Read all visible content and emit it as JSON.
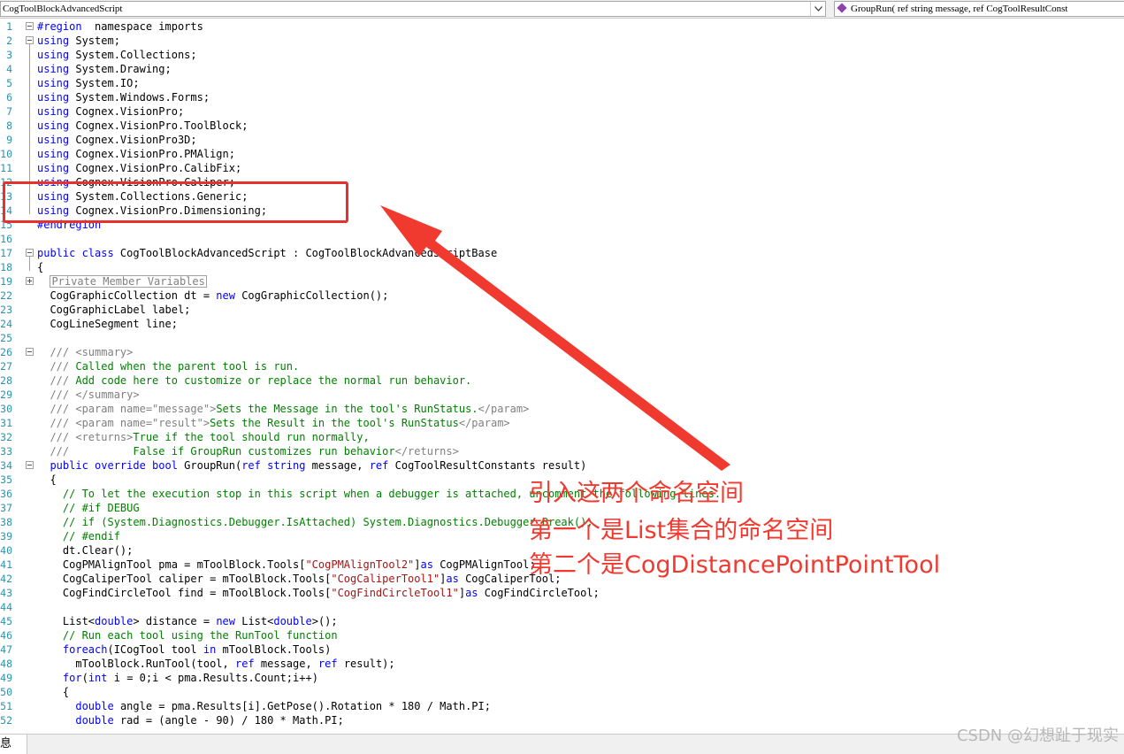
{
  "toolbar": {
    "class_combo": "CogToolBlockAdvancedScript",
    "method_combo": "GroupRun( ref string message,  ref CogToolResultConst"
  },
  "code_lines": [
    {
      "n": "1",
      "fold": "minus",
      "parts": [
        [
          "kw",
          "#region"
        ],
        [
          "",
          "  namespace imports"
        ]
      ]
    },
    {
      "n": "2",
      "fold": "minus",
      "parts": [
        [
          "kw",
          "using"
        ],
        [
          "",
          " System;"
        ]
      ]
    },
    {
      "n": "3",
      "parts": [
        [
          "kw",
          "using"
        ],
        [
          "",
          " System.Collections;"
        ]
      ]
    },
    {
      "n": "4",
      "parts": [
        [
          "kw",
          "using"
        ],
        [
          "",
          " System.Drawing;"
        ]
      ]
    },
    {
      "n": "5",
      "parts": [
        [
          "kw",
          "using"
        ],
        [
          "",
          " System.IO;"
        ]
      ]
    },
    {
      "n": "6",
      "parts": [
        [
          "kw",
          "using"
        ],
        [
          "",
          " System.Windows.Forms;"
        ]
      ]
    },
    {
      "n": "7",
      "parts": [
        [
          "kw",
          "using"
        ],
        [
          "",
          " Cognex.VisionPro;"
        ]
      ]
    },
    {
      "n": "8",
      "parts": [
        [
          "kw",
          "using"
        ],
        [
          "",
          " Cognex.VisionPro.ToolBlock;"
        ]
      ]
    },
    {
      "n": "9",
      "parts": [
        [
          "kw",
          "using"
        ],
        [
          "",
          " Cognex.VisionPro3D;"
        ]
      ]
    },
    {
      "n": "10",
      "parts": [
        [
          "kw",
          "using"
        ],
        [
          "",
          " Cognex.VisionPro.PMAlign;"
        ]
      ]
    },
    {
      "n": "11",
      "parts": [
        [
          "kw",
          "using"
        ],
        [
          "",
          " Cognex.VisionPro.CalibFix;"
        ]
      ]
    },
    {
      "n": "12",
      "parts": [
        [
          "kw",
          "using"
        ],
        [
          "",
          " Cognex.VisionPro.Caliper;"
        ]
      ]
    },
    {
      "n": "13",
      "parts": [
        [
          "kw",
          "using"
        ],
        [
          "",
          " System.Collections.Generic;"
        ]
      ]
    },
    {
      "n": "14",
      "parts": [
        [
          "kw",
          "using"
        ],
        [
          "",
          " Cognex.VisionPro.Dimensioning;"
        ]
      ]
    },
    {
      "n": "15",
      "parts": [
        [
          "kw",
          "#endregion"
        ]
      ]
    },
    {
      "n": "16",
      "parts": []
    },
    {
      "n": "17",
      "fold": "minus",
      "parts": [
        [
          "kw",
          "public class"
        ],
        [
          "",
          " CogToolBlockAdvancedScript : CogToolBlockAdvancedScriptBase"
        ]
      ]
    },
    {
      "n": "18",
      "parts": [
        [
          "",
          "{"
        ]
      ]
    },
    {
      "n": "19",
      "fold": "plus",
      "indent": "  ",
      "parts": [
        [
          "collapsed",
          "Private Member Variables"
        ]
      ]
    },
    {
      "n": "22",
      "indent": "  ",
      "parts": [
        [
          "",
          "CogGraphicCollection dt = "
        ],
        [
          "kw",
          "new"
        ],
        [
          "",
          " CogGraphicCollection();"
        ]
      ]
    },
    {
      "n": "23",
      "indent": "  ",
      "parts": [
        [
          "",
          "CogGraphicLabel label;"
        ]
      ]
    },
    {
      "n": "24",
      "indent": "  ",
      "parts": [
        [
          "",
          "CogLineSegment line;"
        ]
      ]
    },
    {
      "n": "25",
      "parts": []
    },
    {
      "n": "26",
      "fold": "minus",
      "indent": "  ",
      "parts": [
        [
          "xml",
          "/// "
        ],
        [
          "xml",
          "<summary>"
        ]
      ]
    },
    {
      "n": "27",
      "indent": "  ",
      "parts": [
        [
          "xml",
          "/// "
        ],
        [
          "cm",
          "Called when the parent tool is run."
        ]
      ]
    },
    {
      "n": "28",
      "indent": "  ",
      "parts": [
        [
          "xml",
          "/// "
        ],
        [
          "cm",
          "Add code here to customize or replace the normal run behavior."
        ]
      ]
    },
    {
      "n": "29",
      "indent": "  ",
      "parts": [
        [
          "xml",
          "/// "
        ],
        [
          "xml",
          "</summary>"
        ]
      ]
    },
    {
      "n": "30",
      "indent": "  ",
      "parts": [
        [
          "xml",
          "/// "
        ],
        [
          "xml",
          "<param name=\"message\">"
        ],
        [
          "cm",
          "Sets the Message in the tool's RunStatus."
        ],
        [
          "xml",
          "</param>"
        ]
      ]
    },
    {
      "n": "31",
      "indent": "  ",
      "parts": [
        [
          "xml",
          "/// "
        ],
        [
          "xml",
          "<param name=\"result\">"
        ],
        [
          "cm",
          "Sets the Result in the tool's RunStatus"
        ],
        [
          "xml",
          "</param>"
        ]
      ]
    },
    {
      "n": "32",
      "indent": "  ",
      "parts": [
        [
          "xml",
          "/// "
        ],
        [
          "xml",
          "<returns>"
        ],
        [
          "cm",
          "True if the tool should run normally,"
        ]
      ]
    },
    {
      "n": "33",
      "indent": "  ",
      "parts": [
        [
          "xml",
          "///"
        ],
        [
          "cm",
          "          False if GroupRun customizes run behavior"
        ],
        [
          "xml",
          "</returns>"
        ]
      ]
    },
    {
      "n": "34",
      "fold": "minus",
      "indent": "  ",
      "parts": [
        [
          "kw",
          "public override bool"
        ],
        [
          "",
          " GroupRun("
        ],
        [
          "kw",
          "ref string"
        ],
        [
          "",
          " message, "
        ],
        [
          "kw",
          "ref"
        ],
        [
          "",
          " CogToolResultConstants result)"
        ]
      ]
    },
    {
      "n": "35",
      "indent": "  ",
      "parts": [
        [
          "",
          "{"
        ]
      ]
    },
    {
      "n": "36",
      "indent": "    ",
      "parts": [
        [
          "cm",
          "// To let the execution stop in this script when a debugger is attached, uncomment the following lines."
        ]
      ]
    },
    {
      "n": "37",
      "indent": "    ",
      "parts": [
        [
          "cm",
          "// #if DEBUG"
        ]
      ]
    },
    {
      "n": "38",
      "indent": "    ",
      "parts": [
        [
          "cm",
          "// if (System.Diagnostics.Debugger.IsAttached) System.Diagnostics.Debugger.Break();"
        ]
      ]
    },
    {
      "n": "39",
      "indent": "    ",
      "parts": [
        [
          "cm",
          "// #endif"
        ]
      ]
    },
    {
      "n": "40",
      "indent": "    ",
      "parts": [
        [
          "",
          "dt.Clear();"
        ]
      ]
    },
    {
      "n": "41",
      "indent": "    ",
      "parts": [
        [
          "",
          "CogPMAlignTool pma = mToolBlock.Tools["
        ],
        [
          "str",
          "\"CogPMAlignTool2\""
        ],
        [
          "",
          "]"
        ],
        [
          "kw",
          "as"
        ],
        [
          "",
          " CogPMAlignTool;"
        ]
      ]
    },
    {
      "n": "42",
      "indent": "    ",
      "parts": [
        [
          "",
          "CogCaliperTool caliper = mToolBlock.Tools["
        ],
        [
          "str",
          "\"CogCaliperTool1\""
        ],
        [
          "",
          "]"
        ],
        [
          "kw",
          "as"
        ],
        [
          "",
          " CogCaliperTool;"
        ]
      ]
    },
    {
      "n": "43",
      "indent": "    ",
      "parts": [
        [
          "",
          "CogFindCircleTool find = mToolBlock.Tools["
        ],
        [
          "str",
          "\"CogFindCircleTool1\""
        ],
        [
          "",
          "]"
        ],
        [
          "kw",
          "as"
        ],
        [
          "",
          " CogFindCircleTool;"
        ]
      ]
    },
    {
      "n": "44",
      "parts": []
    },
    {
      "n": "45",
      "indent": "    ",
      "parts": [
        [
          "",
          "List<"
        ],
        [
          "kw",
          "double"
        ],
        [
          "",
          "> distance = "
        ],
        [
          "kw",
          "new"
        ],
        [
          "",
          " List<"
        ],
        [
          "kw",
          "double"
        ],
        [
          "",
          ">();"
        ]
      ]
    },
    {
      "n": "46",
      "indent": "    ",
      "parts": [
        [
          "cm",
          "// Run each tool using the RunTool function"
        ]
      ]
    },
    {
      "n": "47",
      "indent": "    ",
      "parts": [
        [
          "kw",
          "foreach"
        ],
        [
          "",
          "(ICogTool tool "
        ],
        [
          "kw",
          "in"
        ],
        [
          "",
          " mToolBlock.Tools)"
        ]
      ]
    },
    {
      "n": "48",
      "indent": "      ",
      "parts": [
        [
          "",
          "mToolBlock.RunTool(tool, "
        ],
        [
          "kw",
          "ref"
        ],
        [
          "",
          " message, "
        ],
        [
          "kw",
          "ref"
        ],
        [
          "",
          " result);"
        ]
      ]
    },
    {
      "n": "49",
      "indent": "    ",
      "parts": [
        [
          "kw",
          "for"
        ],
        [
          "",
          "("
        ],
        [
          "kw",
          "int"
        ],
        [
          "",
          " i = 0;i < pma.Results.Count;i++)"
        ]
      ]
    },
    {
      "n": "50",
      "indent": "    ",
      "parts": [
        [
          "",
          "{"
        ]
      ]
    },
    {
      "n": "51",
      "indent": "      ",
      "parts": [
        [
          "kw",
          "double"
        ],
        [
          "",
          " angle = pma.Results[i].GetPose().Rotation * 180 / Math.PI;"
        ]
      ]
    },
    {
      "n": "52",
      "indent": "      ",
      "parts": [
        [
          "kw",
          "double"
        ],
        [
          "",
          " rad = (angle - 90) / 180 * Math.PI;"
        ]
      ]
    }
  ],
  "annotations": [
    "引入这两个命名空间",
    "第一个是List集合的命名空间",
    "第二个是CogDistancePointPointTool"
  ],
  "colors": {
    "annotation": "#f03a30",
    "keyword": "#0000ff",
    "comment": "#008000",
    "string": "#a31515",
    "line_number": "#2b91af"
  },
  "bottom_tab_label": "息",
  "watermark": "CSDN @幻想趾于现实"
}
